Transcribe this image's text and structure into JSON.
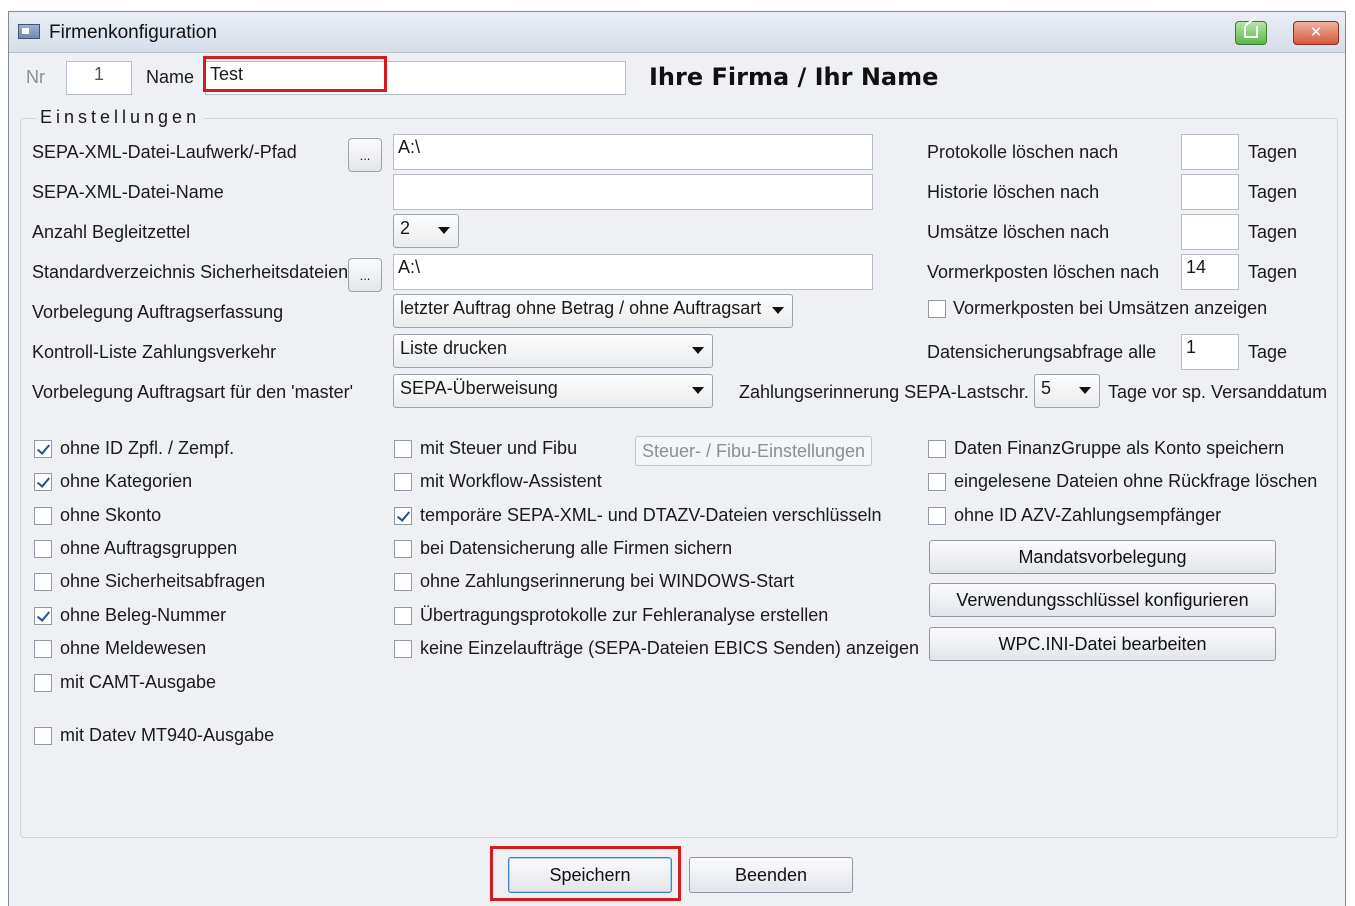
{
  "window": {
    "title": "Firmenkonfiguration",
    "close_label": "✕"
  },
  "header": {
    "nr_label": "Nr",
    "nr_value": "1",
    "name_label": "Name",
    "name_value": "Test",
    "firm_caption": "Ihre Firma / Ihr Name"
  },
  "group_title": "Einstellungen",
  "left_fields": {
    "sepa_path_label": "SEPA-XML-Datei-Laufwerk/-Pfad",
    "sepa_path_value": "A:\\",
    "sepa_name_label": "SEPA-XML-Datei-Name",
    "sepa_name_value": "",
    "begleit_label": "Anzahl Begleitzettel",
    "begleit_value": "2",
    "sicher_label": "Standardverzeichnis Sicherheitsdateien",
    "sicher_value": "A:\\",
    "vorbelegung_label": "Vorbelegung Auftragserfassung",
    "vorbelegung_value": "letzter Auftrag ohne Betrag / ohne Auftragsart",
    "kontroll_label": "Kontroll-Liste Zahlungsverkehr",
    "kontroll_value": "Liste drucken",
    "master_label": "Vorbelegung Auftragsart für den 'master'",
    "master_value": "SEPA-Überweisung",
    "browse_label": "..."
  },
  "right_fields": {
    "protokolle_label": "Protokolle löschen nach",
    "protokolle_value": "",
    "historie_label": "Historie löschen nach",
    "historie_value": "",
    "umsaetze_label": "Umsätze löschen nach",
    "umsaetze_value": "",
    "vormerk_label": "Vormerkposten löschen nach",
    "vormerk_value": "14",
    "tagen_unit": "Tagen",
    "vormerk_umsatz_label": "Vormerkposten bei Umsätzen anzeigen",
    "datensicherung_label": "Datensicherungsabfrage alle",
    "datensicherung_value": "1",
    "tage_unit": "Tage",
    "erinnerung_label": "Zahlungserinnerung SEPA-Lastschr.",
    "erinnerung_value": "5",
    "erinnerung_suffix": "Tage vor sp. Versanddatum"
  },
  "checkboxes_col1": [
    {
      "label": "ohne ID Zpfl. / Zempf.",
      "checked": true
    },
    {
      "label": "ohne Kategorien",
      "checked": true
    },
    {
      "label": "ohne Skonto",
      "checked": false
    },
    {
      "label": "ohne Auftragsgruppen",
      "checked": false
    },
    {
      "label": "ohne Sicherheitsabfragen",
      "checked": false
    },
    {
      "label": "ohne Beleg-Nummer",
      "checked": true
    },
    {
      "label": "ohne Meldewesen",
      "checked": false
    },
    {
      "label": "mit CAMT-Ausgabe",
      "checked": false
    },
    {
      "label": "mit Datev MT940-Ausgabe",
      "checked": false
    }
  ],
  "checkboxes_col2": [
    {
      "label": "mit Steuer und Fibu",
      "checked": false
    },
    {
      "label": "mit Workflow-Assistent",
      "checked": false
    },
    {
      "label": "temporäre SEPA-XML- und DTAZV-Dateien verschlüsseln",
      "checked": true
    },
    {
      "label": "bei Datensicherung alle Firmen sichern",
      "checked": false
    },
    {
      "label": "ohne Zahlungserinnerung bei WINDOWS-Start",
      "checked": false
    },
    {
      "label": "Übertragungsprotokolle zur Fehleranalyse erstellen",
      "checked": false
    },
    {
      "label": "keine Einzelaufträge (SEPA-Dateien EBICS Senden) anzeigen",
      "checked": false
    }
  ],
  "checkboxes_col3": [
    {
      "label": "Daten FinanzGruppe als Konto speichern",
      "checked": false
    },
    {
      "label": "eingelesene Dateien ohne Rückfrage löschen",
      "checked": false
    },
    {
      "label": "ohne ID AZV-Zahlungsempfänger",
      "checked": false
    }
  ],
  "buttons": {
    "steuer_fibu": "Steuer- / Fibu-Einstellungen",
    "mandats": "Mandatsvorbelegung",
    "verwendung": "Verwendungsschlüssel konfigurieren",
    "wpcini": "WPC.INI-Datei bearbeiten",
    "speichern": "Speichern",
    "beenden": "Beenden"
  },
  "colors": {
    "highlight": "#d71920",
    "window_bg": "#eef0f3"
  }
}
